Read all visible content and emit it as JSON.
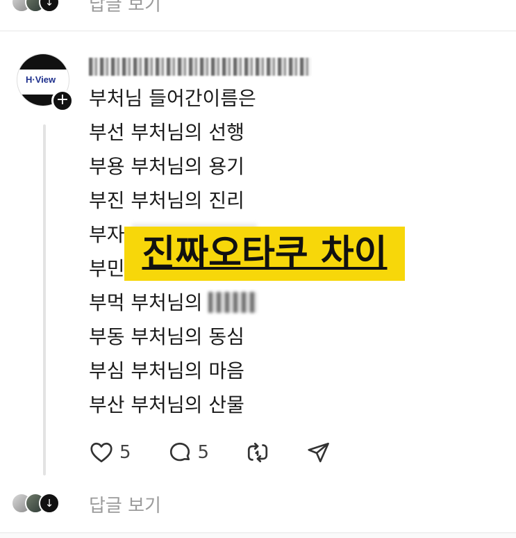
{
  "top_replies": {
    "label": "답글 보기"
  },
  "post": {
    "avatar_logo": "H·View",
    "lines": [
      "부처님 들어간이름은",
      "부선 부처님의 선행",
      "부용 부처님의 용기",
      "부진 부처님의 진리",
      "부자",
      "부민",
      "부먹 부처님의",
      "부동 부처님의 동심",
      "부심 부처님의 마음",
      "부산 부처님의 산물"
    ],
    "overlay_caption": "진짜오타쿠 차이",
    "likes": "5",
    "comments": "5"
  },
  "bottom_replies": {
    "label": "답글 보기"
  },
  "colors": {
    "overlay": "#f7d70a",
    "text": "#1a1a1a",
    "muted": "#9a9a9a"
  },
  "icons": [
    "heart-icon",
    "comment-icon",
    "repost-icon",
    "send-icon",
    "plus-icon",
    "chevron-down-icon"
  ]
}
